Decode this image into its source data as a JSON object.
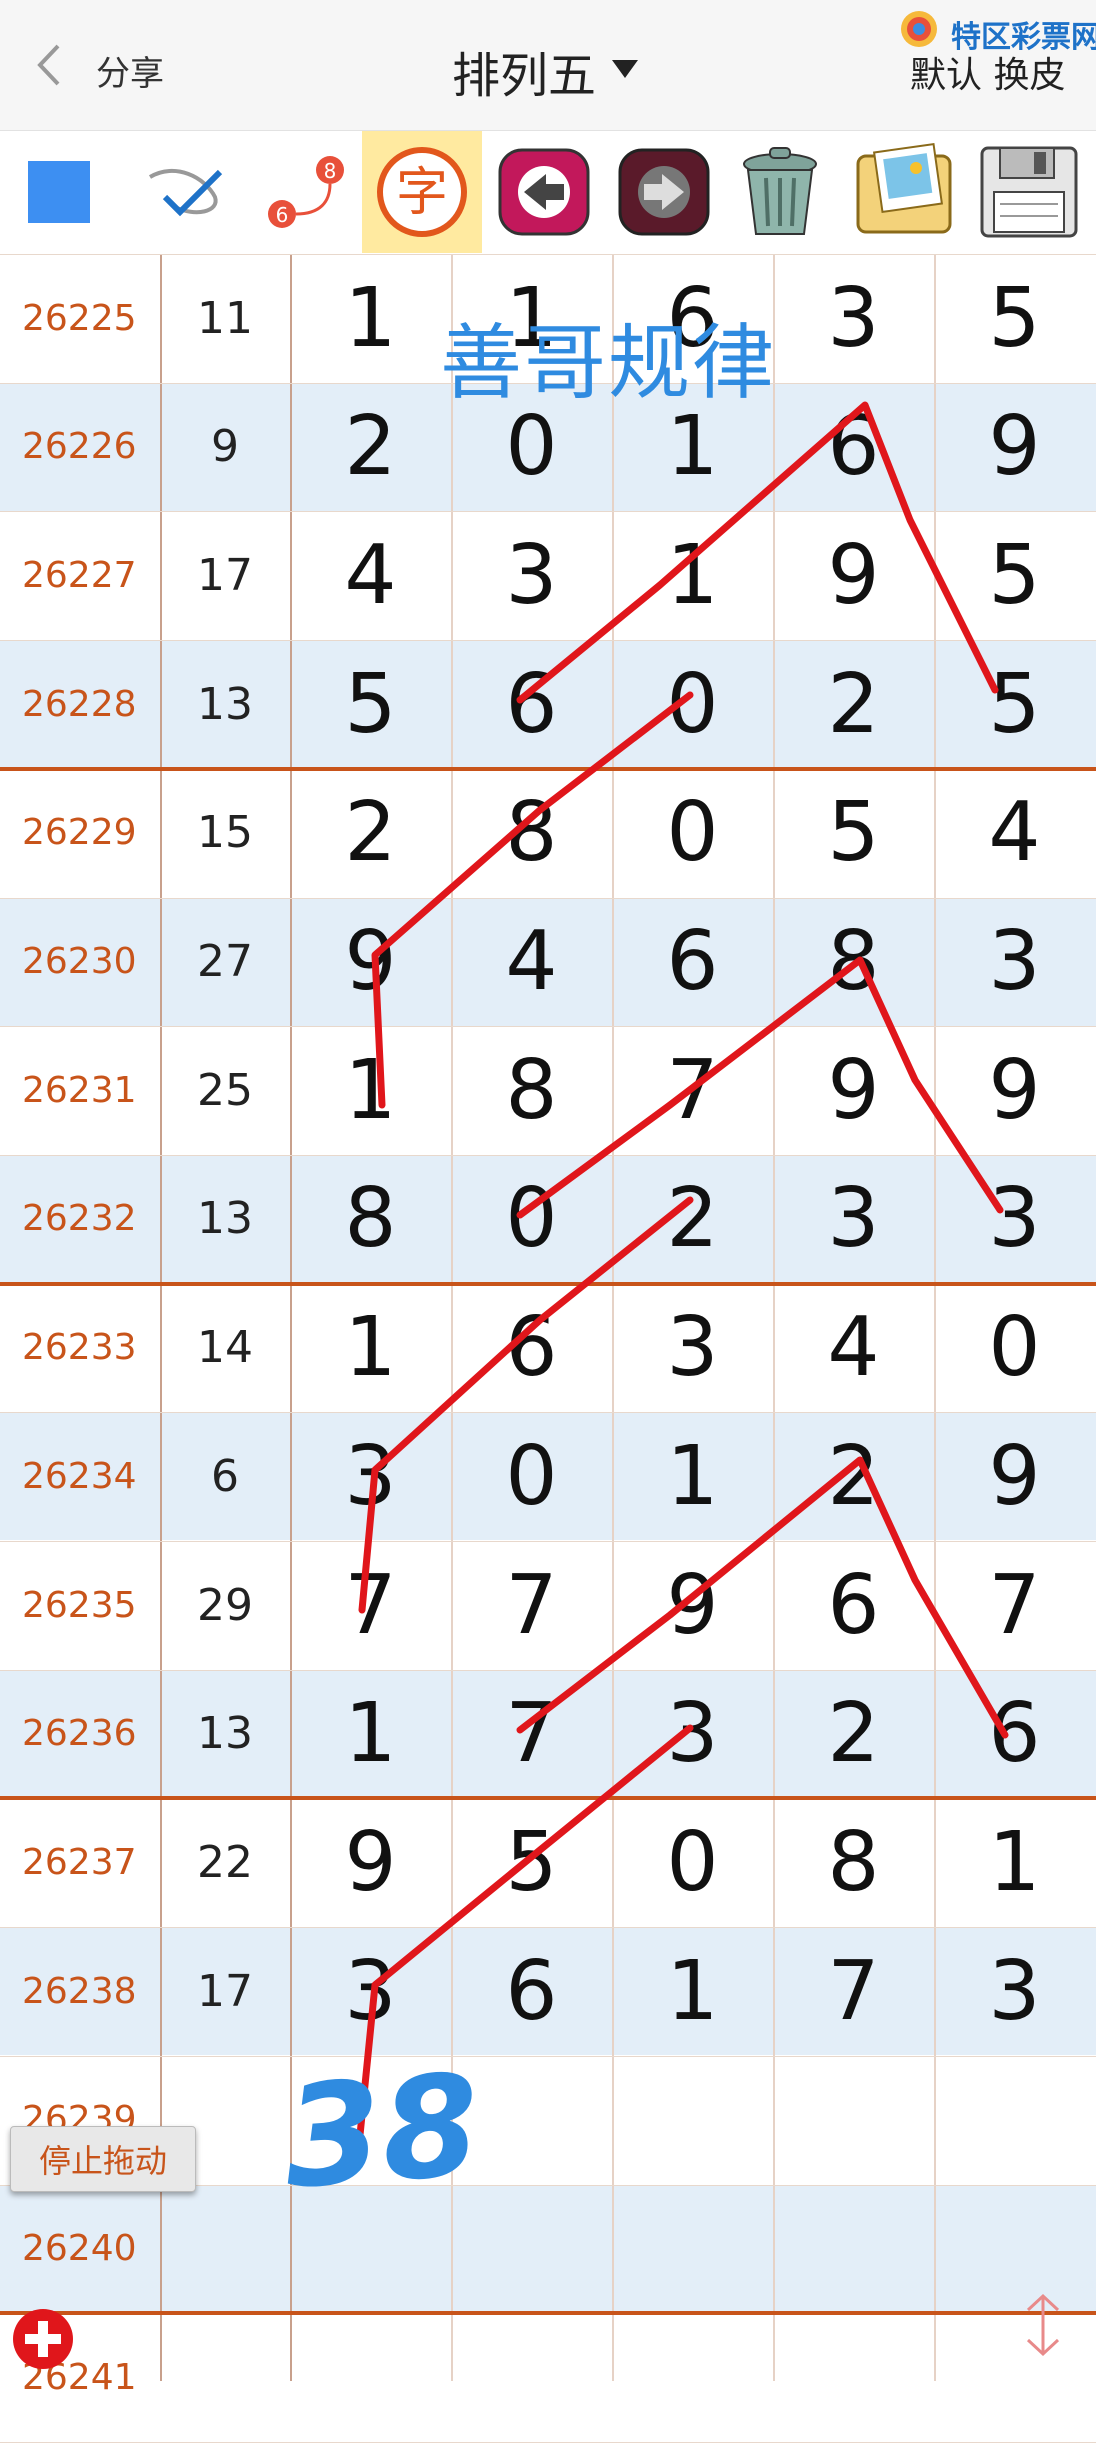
{
  "header": {
    "back_label": "分享",
    "title": "排列五",
    "right_label": "默认 换皮",
    "logo_text": "特区彩票网"
  },
  "toolbar": {
    "color_swatch": "#3d8ff2",
    "tools": [
      "color-picker",
      "pen-icon",
      "line-icon",
      "text-icon",
      "undo-icon",
      "redo-icon",
      "trash-icon",
      "image-icon",
      "save-icon"
    ],
    "text_tool_label": "字",
    "line_tool_start": "6",
    "line_tool_end": "8"
  },
  "rows": [
    {
      "issue": "26225",
      "sum": "11",
      "digits": [
        "1",
        "1",
        "6",
        "3",
        "5"
      ]
    },
    {
      "issue": "26226",
      "sum": "9",
      "digits": [
        "2",
        "0",
        "1",
        "6",
        "9"
      ]
    },
    {
      "issue": "26227",
      "sum": "17",
      "digits": [
        "4",
        "3",
        "1",
        "9",
        "5"
      ]
    },
    {
      "issue": "26228",
      "sum": "13",
      "digits": [
        "5",
        "6",
        "0",
        "2",
        "5"
      ]
    },
    {
      "issue": "26229",
      "sum": "15",
      "digits": [
        "2",
        "8",
        "0",
        "5",
        "4"
      ]
    },
    {
      "issue": "26230",
      "sum": "27",
      "digits": [
        "9",
        "4",
        "6",
        "8",
        "3"
      ]
    },
    {
      "issue": "26231",
      "sum": "25",
      "digits": [
        "1",
        "8",
        "7",
        "9",
        "9"
      ]
    },
    {
      "issue": "26232",
      "sum": "13",
      "digits": [
        "8",
        "0",
        "2",
        "3",
        "3"
      ]
    },
    {
      "issue": "26233",
      "sum": "14",
      "digits": [
        "1",
        "6",
        "3",
        "4",
        "0"
      ]
    },
    {
      "issue": "26234",
      "sum": "6",
      "digits": [
        "3",
        "0",
        "1",
        "2",
        "9"
      ]
    },
    {
      "issue": "26235",
      "sum": "29",
      "digits": [
        "7",
        "7",
        "9",
        "6",
        "7"
      ]
    },
    {
      "issue": "26236",
      "sum": "13",
      "digits": [
        "1",
        "7",
        "3",
        "2",
        "6"
      ]
    },
    {
      "issue": "26237",
      "sum": "22",
      "digits": [
        "9",
        "5",
        "0",
        "8",
        "1"
      ]
    },
    {
      "issue": "26238",
      "sum": "17",
      "digits": [
        "3",
        "6",
        "1",
        "7",
        "3"
      ]
    },
    {
      "issue": "26239",
      "sum": "",
      "digits": [
        "",
        "",
        "",
        "",
        ""
      ]
    },
    {
      "issue": "26240",
      "sum": "",
      "digits": [
        "",
        "",
        "",
        "",
        ""
      ]
    },
    {
      "issue": "26241",
      "sum": "",
      "digits": [
        "",
        "",
        "",
        "",
        ""
      ]
    }
  ],
  "annotations": {
    "watermark": "善哥规律",
    "prediction": "38",
    "pen_color": "#e0161b",
    "ink_color": "#2f8be0"
  },
  "controls": {
    "stop_drag_label": "停止拖动"
  },
  "colors": {
    "accent": "#c8541a",
    "row_alt": "#e3eef8"
  }
}
